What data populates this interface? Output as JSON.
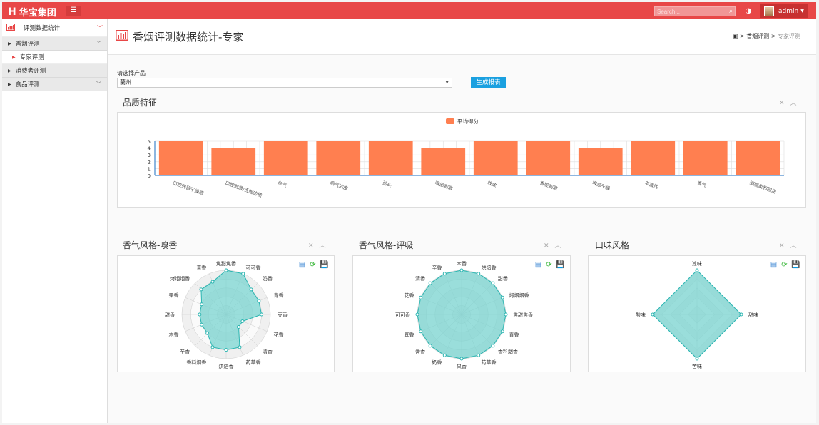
{
  "topbar": {
    "brand": "华宝集团",
    "search_placeholder": "Search...",
    "user": "admin"
  },
  "sidebar": {
    "header": "评测数据统计",
    "items": [
      {
        "label": "香烟评测"
      },
      {
        "label": "专家评测"
      },
      {
        "label": "消费者评测"
      },
      {
        "label": "食品评测"
      }
    ]
  },
  "page": {
    "title": "香烟评测数据统计-专家",
    "breadcrumb": {
      "level1": "香烟评测",
      "sep": ">",
      "current": "专家评测"
    }
  },
  "form": {
    "label": "请选择产品",
    "selected": "蘭州",
    "button": "生成报表"
  },
  "panels": {
    "quality": {
      "title": "品质特征"
    },
    "aroma_smell": {
      "title": "香气风格-嗅香"
    },
    "aroma_taste": {
      "title": "香气风格-评吸"
    },
    "flavor": {
      "title": "口味风格"
    }
  },
  "colors": {
    "brand_red": "#e84747",
    "bar": "#ff7f50",
    "radar_fill": "#7ad4d0",
    "radar_line": "#2bb5b1",
    "button_blue": "#1aa0e0"
  },
  "chart_data": [
    {
      "type": "bar",
      "legend": [
        "平均得分"
      ],
      "categories": [
        "口腔残留干燥感",
        "口腔刺激/舌面的糙",
        "杂气",
        "烟气浓度",
        "劲头",
        "喉部刺激",
        "收敛",
        "香腔刺激",
        "喉部干燥",
        "丰富性",
        "香气",
        "细腻柔和圆润"
      ],
      "series": [
        {
          "name": "平均得分",
          "values": [
            5,
            4,
            5,
            5,
            5,
            4,
            5,
            5,
            4,
            5,
            5,
            5
          ]
        }
      ],
      "ylim": [
        0,
        5
      ],
      "yticks": [
        0,
        1,
        2,
        3,
        4,
        5
      ],
      "grid": true,
      "legend_position": "top-center"
    },
    {
      "type": "radar",
      "indicators": [
        "焦甜焦香",
        "可可香",
        "奶香",
        "青香",
        "豆香",
        "花香",
        "清香",
        "药草香",
        "烘焙香",
        "香料烟香",
        "辛香",
        "木香",
        "甜香",
        "果香",
        "烤烟烟香",
        "膏香"
      ],
      "values": [
        5,
        5,
        4,
        4,
        4,
        2,
        2,
        4,
        4,
        4,
        3,
        3,
        3,
        3,
        4,
        4
      ],
      "max": 5
    },
    {
      "type": "radar",
      "indicators": [
        "木香",
        "烘焙香",
        "甜香",
        "烤烟烟香",
        "焦甜焦香",
        "青香",
        "香料烟香",
        "药草香",
        "果香",
        "奶香",
        "膏香",
        "豆香",
        "可可香",
        "花香",
        "清香",
        "辛香"
      ],
      "values": [
        5,
        5,
        5,
        5,
        5,
        5,
        5,
        5,
        5,
        5,
        5,
        5,
        5,
        5,
        5,
        5
      ],
      "max": 5
    },
    {
      "type": "radar",
      "indicators": [
        "凉味",
        "甜味",
        "苦味",
        "酸味"
      ],
      "values": [
        5,
        5,
        5,
        5
      ],
      "max": 5
    }
  ]
}
